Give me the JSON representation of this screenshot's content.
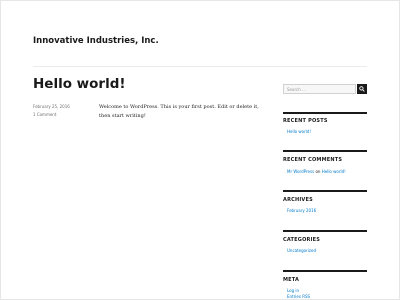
{
  "site": {
    "title": "Innovative Industries, Inc."
  },
  "post": {
    "title": "Hello world!",
    "date": "February 25, 2016",
    "comments": "1 Comment",
    "content": "Welcome to WordPress. This is your first post. Edit or delete it, then start writing!"
  },
  "sidebar": {
    "search": {
      "placeholder": "Search …",
      "icon": "search-icon"
    },
    "recent_posts": {
      "title": "RECENT POSTS",
      "items": [
        "Hello world!"
      ]
    },
    "recent_comments": {
      "title": "RECENT COMMENTS",
      "author": "Mr WordPress",
      "on": "on",
      "post": "Hello world!"
    },
    "archives": {
      "title": "ARCHIVES",
      "items": [
        "February 2016"
      ]
    },
    "categories": {
      "title": "CATEGORIES",
      "items": [
        "Uncategorized"
      ]
    },
    "meta": {
      "title": "META",
      "items": [
        "Log in",
        "Entries RSS"
      ]
    }
  },
  "colors": {
    "link": "#007acc",
    "text": "#1a1a1a",
    "muted": "#707070"
  }
}
